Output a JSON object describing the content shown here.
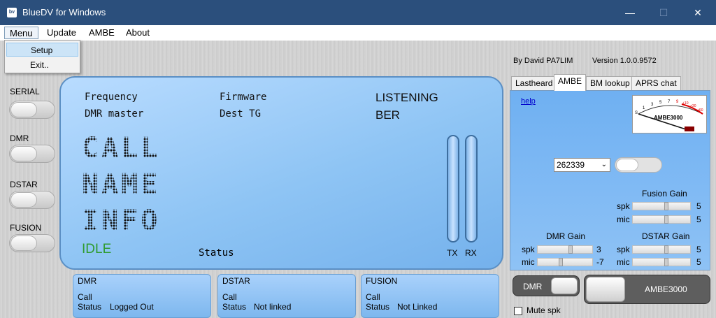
{
  "window": {
    "title": "BlueDV for Windows",
    "icon_text": "bv",
    "minimize": "—",
    "maximize": "☐",
    "close": "✕"
  },
  "menubar": {
    "items": [
      "Menu",
      "Update",
      "AMBE",
      "About"
    ]
  },
  "dropdown": {
    "items": [
      "Setup",
      "Exit.."
    ]
  },
  "side": {
    "labels": [
      "SERIAL",
      "DMR",
      "DSTAR",
      "FUSION"
    ]
  },
  "lcd": {
    "frequency": "Frequency",
    "dmr_master": "DMR master",
    "firmware": "Firmware",
    "dest_tg": "Dest TG",
    "listening": "LISTENING",
    "ber": "BER",
    "call": "CALL",
    "name": "NAME",
    "info": "INFO",
    "idle": "IDLE",
    "status": "Status",
    "tx": "TX",
    "rx": "RX"
  },
  "info_boxes": [
    {
      "title": "DMR",
      "call": "Call",
      "status_label": "Status",
      "status_value": "Logged Out"
    },
    {
      "title": "DSTAR",
      "call": "Call",
      "status_label": "Status",
      "status_value": "Not linked"
    },
    {
      "title": "FUSION",
      "call": "Call",
      "status_label": "Status",
      "status_value": "Not Linked"
    }
  ],
  "header": {
    "author": "By David PA7LIM",
    "version": "Version 1.0.0.9572"
  },
  "tabs": [
    "Lastheard",
    "AMBE",
    "BM lookup",
    "APRS chat"
  ],
  "ambe_panel": {
    "help": "help",
    "vu_label": "AMBE3000",
    "vu_scale": [
      "S",
      "1",
      "3",
      "5",
      "7",
      "9",
      "+10",
      "+30",
      "+60"
    ],
    "select_value": "262339",
    "fusion_gain": {
      "title": "Fusion Gain",
      "spk_label": "spk",
      "spk_value": "5",
      "mic_label": "mic",
      "mic_value": "5"
    },
    "dmr_gain": {
      "title": "DMR Gain",
      "spk_label": "spk",
      "spk_value": "3",
      "mic_label": "mic",
      "mic_value": "-7"
    },
    "dstar_gain": {
      "title": "DSTAR Gain",
      "spk_label": "spk",
      "spk_value": "5",
      "mic_label": "mic",
      "mic_value": "5"
    }
  },
  "bottom": {
    "dmr_toggle": "DMR",
    "ambe_button": "AMBE3000",
    "mute_label": "Mute spk"
  }
}
